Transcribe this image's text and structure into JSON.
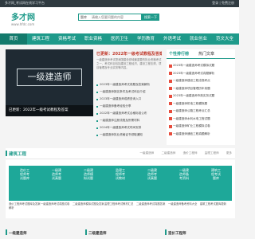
{
  "topbar": {
    "welcome": "多才网_考试网在线学习平台",
    "links": "登录 | 免费注册"
  },
  "header": {
    "logo_name": "多才网",
    "logo_site": "www.hfdc.com",
    "search_label": "题库",
    "search_placeholder": "请输入您要问题的内容",
    "search_button": "搜索一下"
  },
  "nav": {
    "items": [
      "首页",
      "建筑工程",
      "资格考试",
      "职业资格",
      "医药卫生",
      "学历教育",
      "外语考试",
      "就业创业",
      "范文大全"
    ]
  },
  "hero": {
    "banner_text": "一级建造师",
    "caption": "已更新：2022年一级考试教程及答案"
  },
  "news": {
    "headline": "已更新：2022年一级考试教程及答案",
    "summary": "一级建造师考试是我国建设领域最重要的执业资格考试之一，考试科目包括建设工程经济、建设工程法规、项目管理及专业实务等内容。",
    "items": [
      "2023年一级建造师考试真题及答案解析",
      "一级建造师报名条件及考试科目介绍",
      "2023年一级建造师成绩查询入口",
      "一级建造师备考经验分享",
      "2022年一级建造师考试合格标准公布",
      "一级建造师注册流程及所需材料",
      "2024年一级建造师考试时间安排",
      "一级建造师执业资格证书领取通知"
    ]
  },
  "sidepanel": {
    "tabs": [
      "个性排行榜",
      "热门文章"
    ],
    "items": [
      "2023年一级建造师考试模拟试题",
      "2023年一级建造师考试真题解析",
      "一级建造师建设工程法规考点",
      "一级建造师项目管理历年真题",
      "2023年一级建造师市政实务试题",
      "一级建造师机电工程模拟题",
      "一级建造师公路工程考点汇总",
      "一级建造师水利水电工程试题",
      "一级建造师矿业工程模拟试卷",
      "一级建造师通信工程真题解析"
    ]
  },
  "section": {
    "title": "建筑工程",
    "subtabs": [
      "一级建造师",
      "二级建造师",
      "造价工程师",
      "监理工程师",
      "更多"
    ],
    "cards": [
      {
        "thumb": "造价工程师考试题库",
        "title": "造价工程师考试题库及答案解析"
      },
      {
        "thumb": "一级建造师考试真题",
        "title": "一级建造师考试真题试卷"
      },
      {
        "thumb": "二级建造师模拟试题",
        "title": "二级建造师模拟试题及答案"
      },
      {
        "thumb": "监理工程师考试教材",
        "title": "监理工程师考试教材汇总"
      },
      {
        "thumb": "二级建造师考试真题",
        "title": "二级建造师考试真题答案"
      },
      {
        "thumb": "一级建造师备考资料",
        "title": "一级建造师备考资料大全"
      },
      {
        "thumb": "建筑工程考试题库",
        "title": "建筑工程考试题库更新"
      }
    ]
  },
  "bottom": {
    "titles": [
      "一级建造师",
      "二级建造师",
      "造价工程师"
    ]
  }
}
